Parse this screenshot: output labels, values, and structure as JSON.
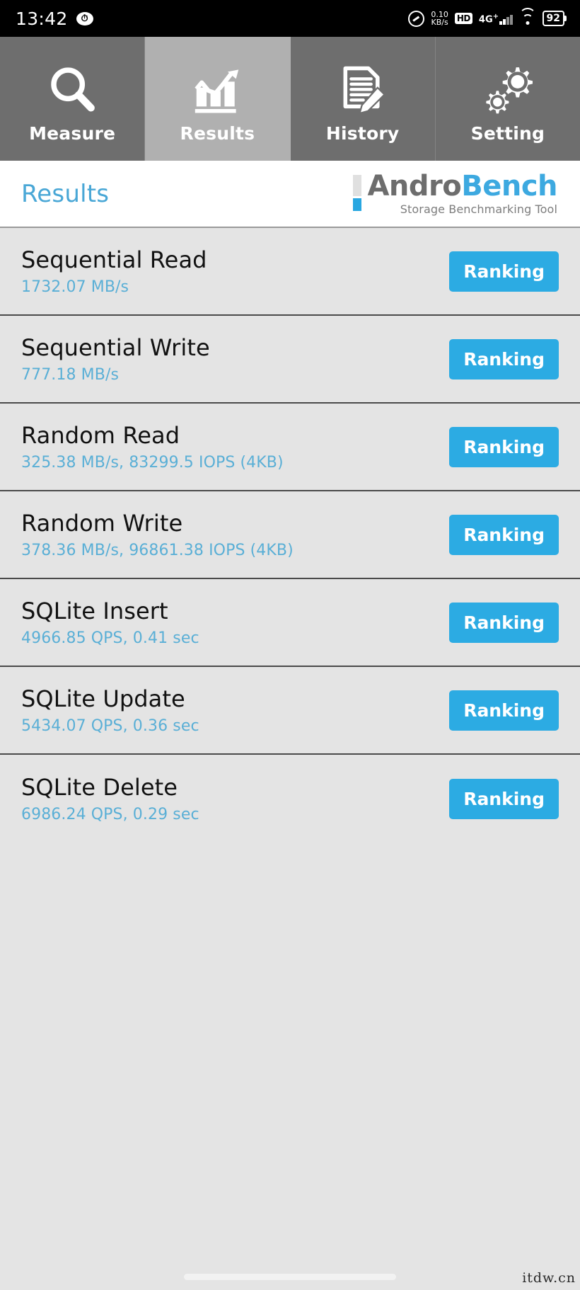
{
  "statusbar": {
    "clock": "13:42",
    "alarm_icon": "alarm-icon",
    "network_speed": "0.10",
    "network_speed_unit": "KB/s",
    "hd_label": "HD",
    "network_type": "4G",
    "network_type_sup": "+",
    "battery_percent": "92",
    "wifi_icon": "wifi-icon"
  },
  "tabs": [
    {
      "label": "Measure",
      "icon": "magnifier-icon",
      "active": false
    },
    {
      "label": "Results",
      "icon": "bar-chart-icon",
      "active": true
    },
    {
      "label": "History",
      "icon": "document-pencil-icon",
      "active": false
    },
    {
      "label": "Setting",
      "icon": "gears-icon",
      "active": false
    }
  ],
  "header": {
    "page_title": "Results",
    "logo_primary": "Andro",
    "logo_secondary": "Bench",
    "logo_subtitle": "Storage Benchmarking Tool"
  },
  "results": [
    {
      "title": "Sequential Read",
      "value": "1732.07 MB/s",
      "button": "Ranking"
    },
    {
      "title": "Sequential Write",
      "value": "777.18 MB/s",
      "button": "Ranking"
    },
    {
      "title": "Random Read",
      "value": "325.38 MB/s, 83299.5 IOPS (4KB)",
      "button": "Ranking"
    },
    {
      "title": "Random Write",
      "value": "378.36 MB/s, 96861.38 IOPS (4KB)",
      "button": "Ranking"
    },
    {
      "title": "SQLite Insert",
      "value": "4966.85 QPS, 0.41 sec",
      "button": "Ranking"
    },
    {
      "title": "SQLite Update",
      "value": "5434.07 QPS, 0.36 sec",
      "button": "Ranking"
    },
    {
      "title": "SQLite Delete",
      "value": "6986.24 QPS, 0.29 sec",
      "button": "Ranking"
    }
  ],
  "footer": {
    "watermark": "itdw.cn"
  },
  "colors": {
    "accent_blue": "#2cabe3",
    "value_blue": "#5aafd6",
    "title_blue": "#49a7d6",
    "tab_inactive": "#6e6e6e",
    "tab_active": "#b0b0b0",
    "list_bg": "#e4e4e4"
  }
}
